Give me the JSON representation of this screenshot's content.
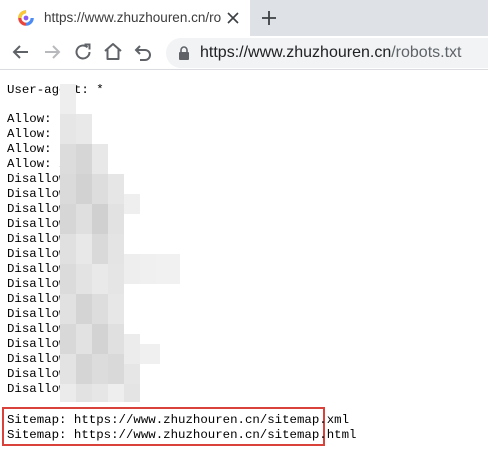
{
  "tab": {
    "title": "https://www.zhuzhouren.cn/robots.txt",
    "favicon": "browser-favicon-icon",
    "close": "close-icon"
  },
  "toolbar": {
    "back": "back-arrow-icon",
    "forward": "forward-arrow-icon",
    "reload": "reload-icon",
    "home": "home-icon",
    "undo": "undo-icon",
    "url_host": "https://www.zhuzhouren.cn",
    "url_path": "/robots.txt"
  },
  "robots": {
    "user_agent": "User-agent: *",
    "allow_lines": [
      "Allow: ",
      "Allow: ",
      "Allow: ",
      "Allow: /"
    ],
    "disallow_lines": [
      "Disallow:",
      "Disallow:",
      "Disallow:",
      "Disallow:",
      "Disallow:",
      "Disallow:",
      "Disallow:",
      "Disallow:",
      "Disallow:",
      "Disallow:",
      "Disallow:",
      "Disallow:",
      "Disallow:",
      "Disallow:",
      "Disallow:"
    ],
    "sitemaps": [
      "Sitemap: https://www.zhuzhouren.cn/sitemap.xml",
      "Sitemap: https://www.zhuzhouren.cn/sitemap.html"
    ]
  },
  "colors": {
    "highlight": "#d9413b",
    "tabstrip": "#dee1e6",
    "omnibox": "#f1f3f4"
  }
}
